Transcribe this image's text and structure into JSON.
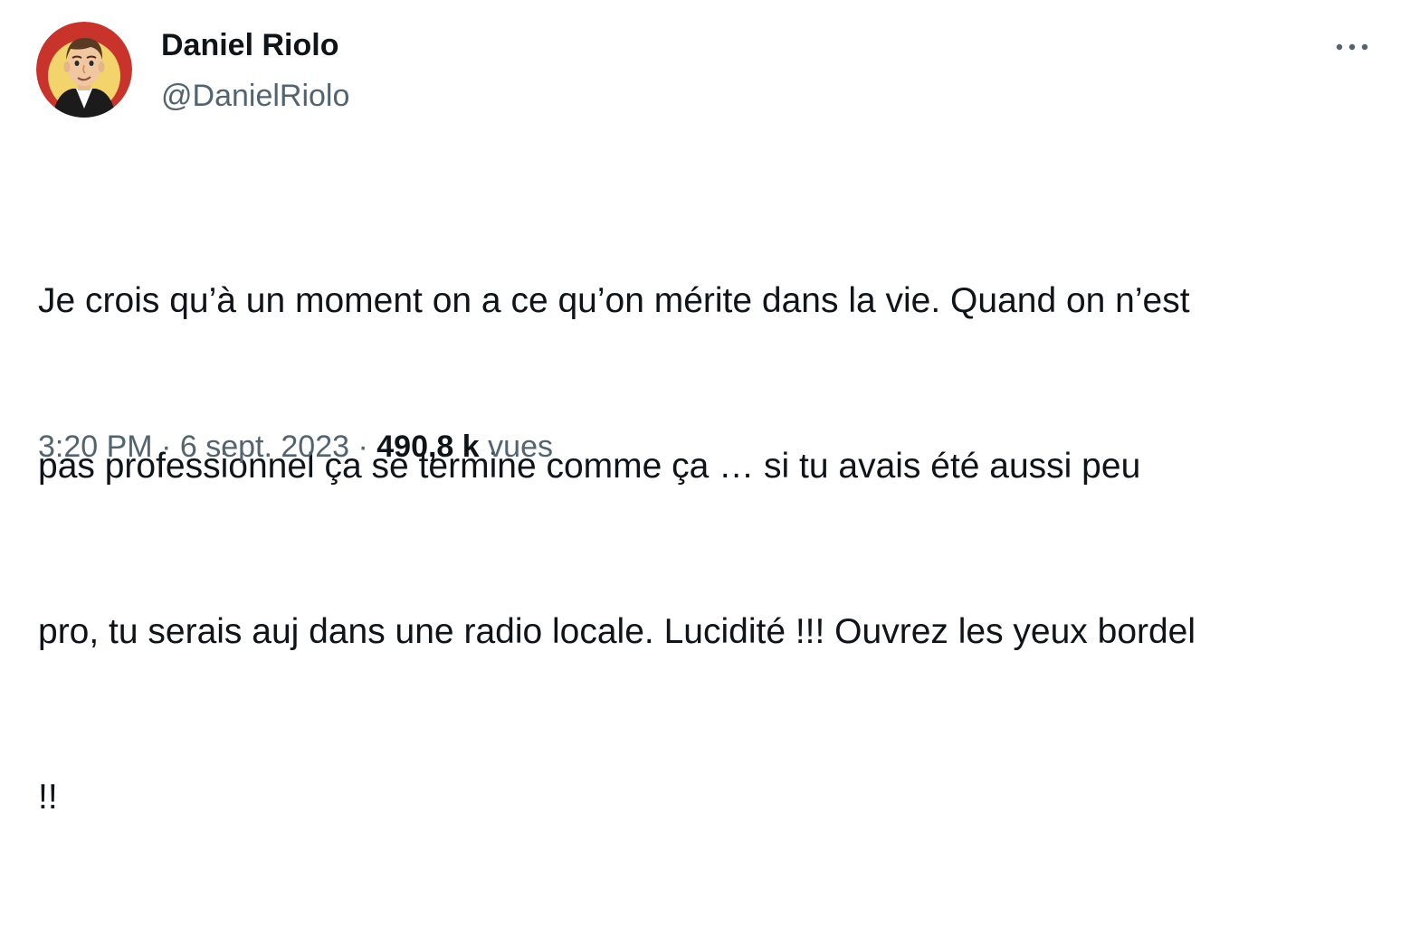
{
  "author": {
    "name": "Daniel Riolo",
    "handle": "@DanielRiolo",
    "avatar_icon": "cartoon-portrait-avatar"
  },
  "menu": {
    "more_icon": "more-horizontal-icon"
  },
  "tweet": {
    "lines": [
      "Je crois qu’à un moment on a ce qu’on mérite dans la vie. Quand on n’est",
      "pas professionnel ça se termine comme ça … si tu avais été aussi peu",
      "pro, tu serais auj dans une radio locale. Lucidité !!! Ouvrez les yeux bordel",
      "!!"
    ]
  },
  "meta": {
    "time": "3:20 PM",
    "separator": "·",
    "date": "6 sept. 2023",
    "views_count": "490,8 k",
    "views_label": "vues"
  },
  "colors": {
    "text": "#0f1419",
    "secondary": "#536471",
    "background": "#ffffff",
    "avatar_ring": "#c8342b",
    "avatar_inner": "#f3d36b"
  }
}
